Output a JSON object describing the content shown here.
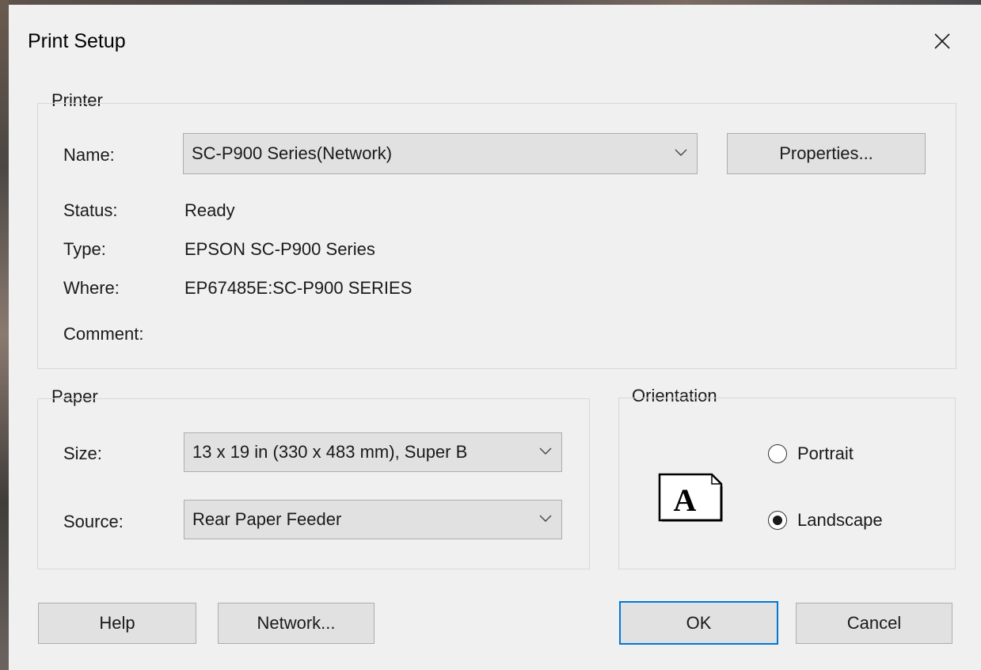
{
  "window": {
    "title": "Print Setup",
    "close_glyph": "✕"
  },
  "printer": {
    "group_label": "Printer",
    "name_label": "Name:",
    "name_value": "SC-P900 Series(Network)",
    "properties_button": "Properties...",
    "status_label": "Status:",
    "status_value": "Ready",
    "type_label": "Type:",
    "type_value": "EPSON SC-P900 Series",
    "where_label": "Where:",
    "where_value": "EP67485E:SC-P900 SERIES",
    "comment_label": "Comment:",
    "comment_value": ""
  },
  "paper": {
    "group_label": "Paper",
    "size_label": "Size:",
    "size_value": "13 x 19 in (330 x 483 mm), Super B",
    "source_label": "Source:",
    "source_value": "Rear Paper Feeder"
  },
  "orientation": {
    "group_label": "Orientation",
    "preview_letter": "A",
    "portrait_label": "Portrait",
    "portrait_checked": false,
    "landscape_label": "Landscape",
    "landscape_checked": true
  },
  "buttons": {
    "help": "Help",
    "network": "Network...",
    "ok": "OK",
    "cancel": "Cancel"
  },
  "icons": {
    "close": "close-icon",
    "dropdown": "chevron-down-icon",
    "orientation_preview": "landscape-page-icon"
  },
  "colors": {
    "dialog_background": "#f0f0f0",
    "button_face": "#e1e1e1",
    "button_border": "#adadad",
    "default_button_border": "#0078d7",
    "group_border": "#d8d8d8"
  }
}
